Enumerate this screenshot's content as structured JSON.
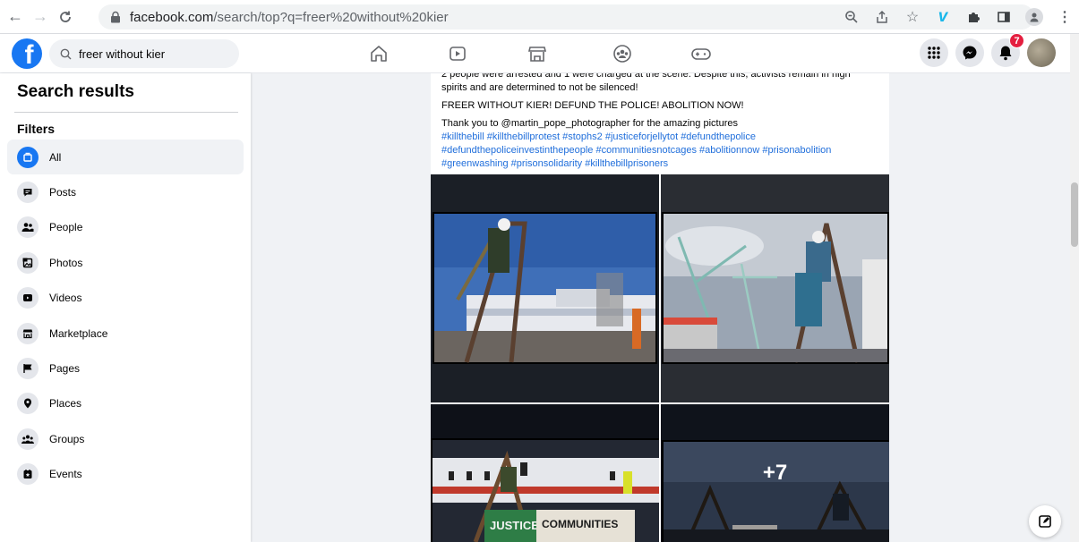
{
  "browser": {
    "url_host": "facebook.com",
    "url_path": "/search/top?q=freer%20without%20kier"
  },
  "fb": {
    "search_value": "freer without kier",
    "notification_count": "7"
  },
  "sidebar": {
    "title": "Search results",
    "filters_label": "Filters",
    "items": [
      {
        "label": "All",
        "icon": "all-icon"
      },
      {
        "label": "Posts",
        "icon": "posts-icon"
      },
      {
        "label": "People",
        "icon": "people-icon"
      },
      {
        "label": "Photos",
        "icon": "photos-icon"
      },
      {
        "label": "Videos",
        "icon": "videos-icon"
      },
      {
        "label": "Marketplace",
        "icon": "marketplace-icon"
      },
      {
        "label": "Pages",
        "icon": "pages-icon"
      },
      {
        "label": "Places",
        "icon": "places-icon"
      },
      {
        "label": "Groups",
        "icon": "groups-icon"
      },
      {
        "label": "Events",
        "icon": "events-icon"
      }
    ]
  },
  "post": {
    "line_cut": "2 people were arrested and 1 were charged at the scene. Despite this, activists remain in high",
    "line_spirits": "spirits and are determined to not be silenced!",
    "slogan": "FREER WITHOUT KIER! DEFUND THE POLICE! ABOLITION NOW!",
    "thanks": "Thank you to @martin_pope_photographer for the amazing pictures",
    "hashtags": "#killthebill #killthebillprotest #stophs2 #justiceforjellytot #defundthepolice #defundthepoliceinvestinthepeople #communitiesnotcages #abolitionnow #prisonabolition #greenwashing #prisonsolidarity #killthebillprisoners",
    "banner_text_1": "JUSTICE",
    "banner_text_2": "COMMUNITIES",
    "more_photos": "+7"
  },
  "colors": {
    "fb_blue": "#1877f2",
    "link": "#216fdb",
    "badge": "#e41e3f"
  }
}
